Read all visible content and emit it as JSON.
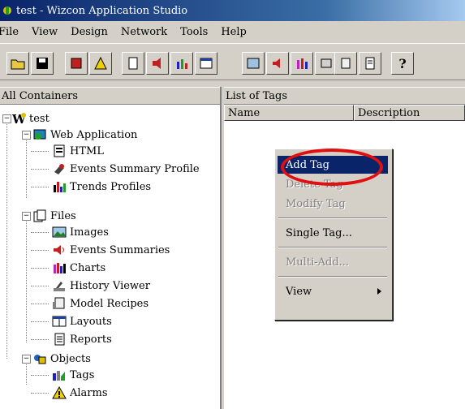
{
  "window": {
    "title": "test - Wizcon Application Studio"
  },
  "menu": [
    "File",
    "View",
    "Design",
    "Network",
    "Tools",
    "Help"
  ],
  "left_pane": {
    "header": "All Containers",
    "tree": [
      {
        "label": "test",
        "icon": "wizcon-logo-icon"
      },
      {
        "label": "Web Application",
        "icon": "web-app-icon"
      },
      {
        "label": "HTML",
        "icon": "html-doc-icon"
      },
      {
        "label": "Events Summary Profile",
        "icon": "events-profile-icon"
      },
      {
        "label": "Trends Profiles",
        "icon": "trends-icon"
      },
      {
        "label": "Files",
        "icon": "files-icon"
      },
      {
        "label": "Images",
        "icon": "images-icon"
      },
      {
        "label": "Events Summaries",
        "icon": "speaker-icon"
      },
      {
        "label": "Charts",
        "icon": "charts-icon"
      },
      {
        "label": "History Viewer",
        "icon": "history-viewer-icon"
      },
      {
        "label": "Model Recipes",
        "icon": "recipes-icon"
      },
      {
        "label": "Layouts",
        "icon": "layouts-icon"
      },
      {
        "label": "Reports",
        "icon": "reports-icon"
      },
      {
        "label": "Objects",
        "icon": "objects-icon"
      },
      {
        "label": "Tags",
        "icon": "tags-icon"
      },
      {
        "label": "Alarms",
        "icon": "alarm-warning-icon"
      }
    ]
  },
  "right_pane": {
    "header": "List of Tags",
    "columns": [
      "Name",
      "Description"
    ]
  },
  "context_menu": {
    "items": [
      {
        "label": "Add Tag",
        "state": "selected"
      },
      {
        "label": "Delete Tag",
        "state": "disabled"
      },
      {
        "label": "Modify Tag",
        "state": "disabled"
      },
      {
        "label": "Single Tag...",
        "state": "enabled"
      },
      {
        "label": "Multi-Add...",
        "state": "disabled"
      },
      {
        "label": "View",
        "state": "enabled"
      }
    ]
  },
  "colors": {
    "highlight": "#0a246a",
    "annotation_circle": "#e01010"
  }
}
